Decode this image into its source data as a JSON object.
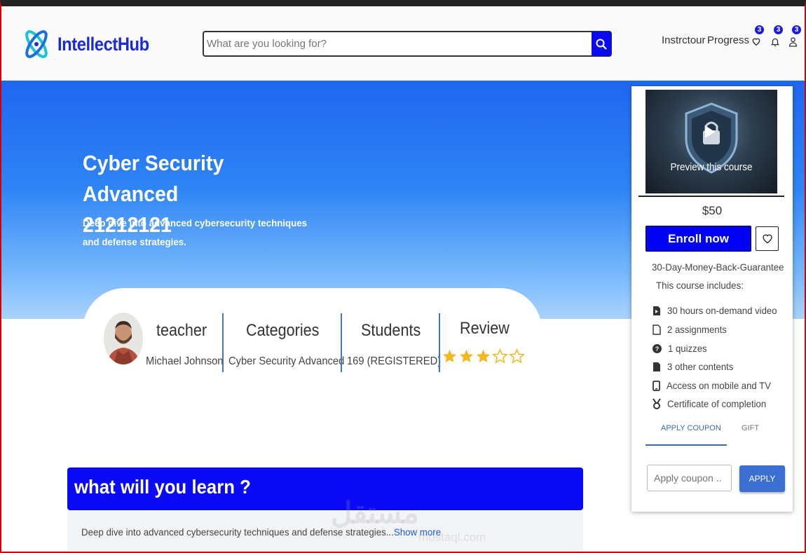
{
  "header": {
    "brand": "IntellectHub",
    "search_placeholder": "What are you looking for?",
    "nav": {
      "instructor": "Instrctour",
      "progress": "Progress"
    },
    "badges": {
      "wishlist": "3",
      "notifications": "3",
      "account": "3"
    }
  },
  "hero": {
    "title_line1": "Cyber Security Advanced",
    "title_line2": "21212121",
    "subtitle": "Deep dive into advanced cybersecurity techniques and defense strategies."
  },
  "info": {
    "teacher_label": "teacher",
    "teacher_name": "Michael Johnson",
    "categories_label": "Categories",
    "category": "Cyber Security Advanced",
    "students_label": "Students",
    "students": "169 (REGISTERED)",
    "review_label": "Review",
    "rating": 3,
    "rating_max": 5
  },
  "learn": {
    "title": "what will you learn ?",
    "text": "Deep dive into advanced cybersecurity techniques and defense strategies...",
    "show_more": "Show more"
  },
  "sidebar": {
    "preview_label": "Preview this course",
    "price": "$50",
    "enroll_label": "Enroll now",
    "guarantee": "30-Day-Money-Back-Guarantee",
    "includes_title": "This course includes:",
    "includes": [
      {
        "icon": "video-file-icon",
        "text": "30 hours on-demand video"
      },
      {
        "icon": "file-icon",
        "text": "2 assignments"
      },
      {
        "icon": "question-icon",
        "text": "1 quizzes"
      },
      {
        "icon": "document-icon",
        "text": "3 other contents"
      },
      {
        "icon": "mobile-icon",
        "text": "Access on mobile and TV"
      },
      {
        "icon": "medal-icon",
        "text": "Certificate of completion"
      }
    ],
    "tabs": {
      "coupon": "APPLY COUPON",
      "gift": "GIFT"
    },
    "coupon_placeholder": "Apply coupon ..",
    "apply_label": "APPLY"
  },
  "watermark": {
    "text": "مستقل",
    "sub": "mostaql.com"
  },
  "colors": {
    "brand": "#1a2bd6",
    "primary": "#0000f5",
    "accent": "#3a78c9",
    "star": "#f2b824"
  }
}
